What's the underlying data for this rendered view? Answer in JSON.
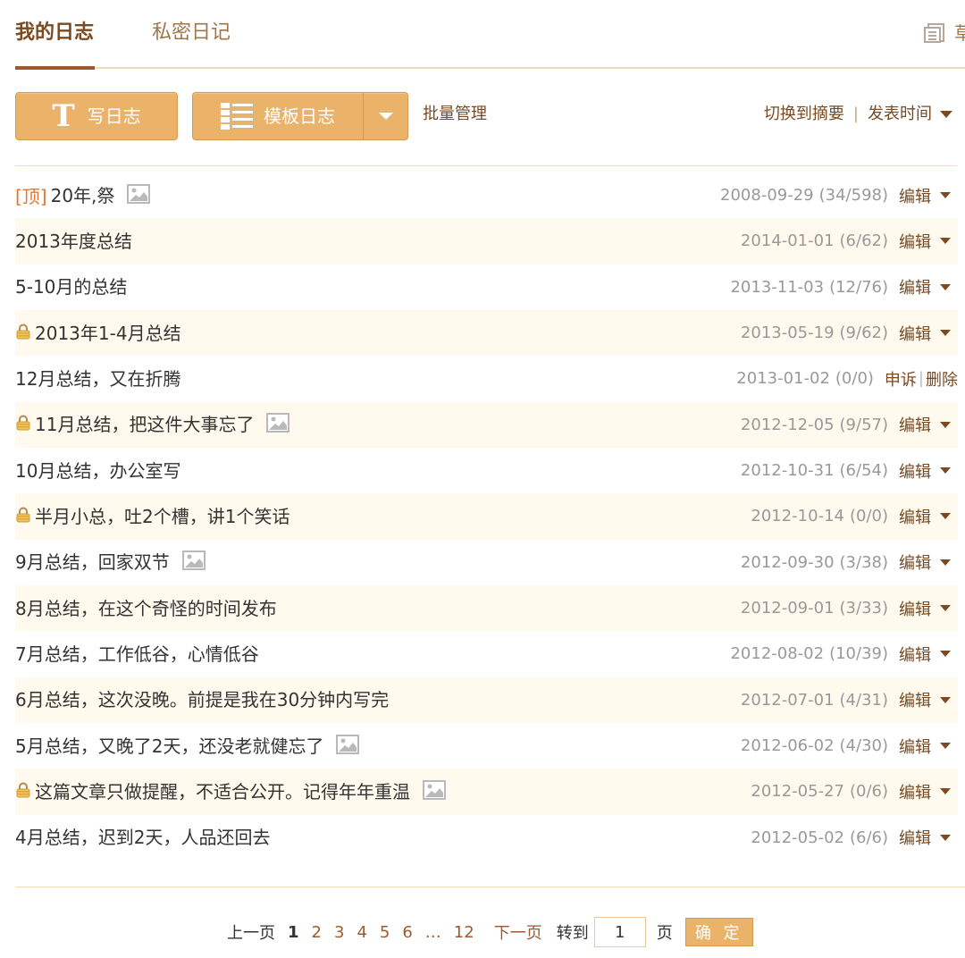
{
  "tabs": {
    "active": "我的日志",
    "private": "私密日记",
    "right_label": "草"
  },
  "toolbar": {
    "write_icon": "T",
    "write_label": "写日志",
    "template_label": "模板日志",
    "batch_label": "批量管理",
    "switch_label": "切换到摘要",
    "separator": "|",
    "sort_label": "发表时间"
  },
  "icons": {
    "write": "letter-t-icon",
    "template": "list-layout-icon",
    "draft": "draft-icon",
    "lock": "lock-icon",
    "image": "image-icon",
    "caret": "caret-down-icon"
  },
  "colors": {
    "accent": "#ebb369",
    "brand_text": "#7a4a22",
    "pin": "#e6762f",
    "row_alt": "#fffaed",
    "meta_text": "#999999"
  },
  "entries": [
    {
      "pinned": true,
      "pin_label": "[顶]",
      "locked": false,
      "title": "20年,祭",
      "has_image": true,
      "date": "2008-09-29",
      "counts": "(34/598)",
      "edit_label": "编辑",
      "alt": false
    },
    {
      "pinned": false,
      "locked": false,
      "title": "2013年度总结",
      "has_image": false,
      "date": "2014-01-01",
      "counts": "(6/62)",
      "edit_label": "编辑",
      "alt": true
    },
    {
      "pinned": false,
      "locked": false,
      "title": "5-10月的总结",
      "has_image": false,
      "date": "2013-11-03",
      "counts": "(12/76)",
      "edit_label": "编辑",
      "alt": false
    },
    {
      "pinned": false,
      "locked": true,
      "title": "2013年1-4月总结",
      "has_image": false,
      "date": "2013-05-19",
      "counts": "(9/62)",
      "edit_label": "编辑",
      "alt": true
    },
    {
      "pinned": false,
      "locked": false,
      "title": "12月总结，又在折腾",
      "has_image": false,
      "date": "2013-01-02",
      "counts": "(0/0)",
      "appeal_label": "申诉",
      "delete_label": "删除",
      "alt": false
    },
    {
      "pinned": false,
      "locked": true,
      "title": "11月总结，把这件大事忘了",
      "has_image": true,
      "date": "2012-12-05",
      "counts": "(9/57)",
      "edit_label": "编辑",
      "alt": true
    },
    {
      "pinned": false,
      "locked": false,
      "title": "10月总结，办公室写",
      "has_image": false,
      "date": "2012-10-31",
      "counts": "(6/54)",
      "edit_label": "编辑",
      "alt": false
    },
    {
      "pinned": false,
      "locked": true,
      "title": "半月小总，吐2个槽，讲1个笑话",
      "has_image": false,
      "date": "2012-10-14",
      "counts": "(0/0)",
      "edit_label": "编辑",
      "alt": true
    },
    {
      "pinned": false,
      "locked": false,
      "title": "9月总结，回家双节",
      "has_image": true,
      "date": "2012-09-30",
      "counts": "(3/38)",
      "edit_label": "编辑",
      "alt": false
    },
    {
      "pinned": false,
      "locked": false,
      "title": "8月总结，在这个奇怪的时间发布",
      "has_image": false,
      "date": "2012-09-01",
      "counts": "(3/33)",
      "edit_label": "编辑",
      "alt": true
    },
    {
      "pinned": false,
      "locked": false,
      "title": "7月总结，工作低谷，心情低谷",
      "has_image": false,
      "date": "2012-08-02",
      "counts": "(10/39)",
      "edit_label": "编辑",
      "alt": false
    },
    {
      "pinned": false,
      "locked": false,
      "title": "6月总结，这次没晚。前提是我在30分钟内写完",
      "has_image": false,
      "date": "2012-07-01",
      "counts": "(4/31)",
      "edit_label": "编辑",
      "alt": true
    },
    {
      "pinned": false,
      "locked": false,
      "title": "5月总结，又晚了2天，还没老就健忘了",
      "has_image": true,
      "date": "2012-06-02",
      "counts": "(4/30)",
      "edit_label": "编辑",
      "alt": false
    },
    {
      "pinned": false,
      "locked": true,
      "title": "这篇文章只做提醒，不适合公开。记得年年重温",
      "has_image": true,
      "date": "2012-05-27",
      "counts": "(0/6)",
      "edit_label": "编辑",
      "alt": true
    },
    {
      "pinned": false,
      "locked": false,
      "title": "4月总结，迟到2天，人品还回去",
      "has_image": false,
      "date": "2012-05-02",
      "counts": "(6/6)",
      "edit_label": "编辑",
      "alt": false
    }
  ],
  "pagination": {
    "prev_label": "上一页",
    "pages": [
      "1",
      "2",
      "3",
      "4",
      "5",
      "6"
    ],
    "current": "1",
    "ellipsis": "…",
    "last_page": "12",
    "next_label": "下一页",
    "goto_label": "转到",
    "input_value": "1",
    "page_unit": "页",
    "confirm_label": "确 定"
  }
}
